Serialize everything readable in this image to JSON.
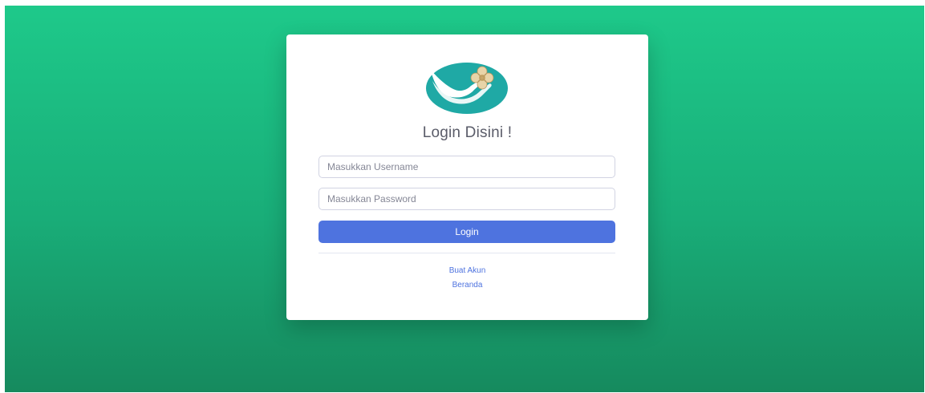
{
  "login": {
    "title": "Login Disini !",
    "username_placeholder": "Masukkan Username",
    "password_placeholder": "Masukkan Password",
    "login_label": "Login",
    "create_account_label": "Buat Akun",
    "home_label": "Beranda"
  },
  "colors": {
    "background_top": "#1ec98a",
    "background_bottom": "#168a5e",
    "button": "#4e73df",
    "logo_teal": "#1fa9a5",
    "logo_flower": "#e8d4a8"
  },
  "icons": {
    "logo": "hand-flower-logo-icon"
  }
}
